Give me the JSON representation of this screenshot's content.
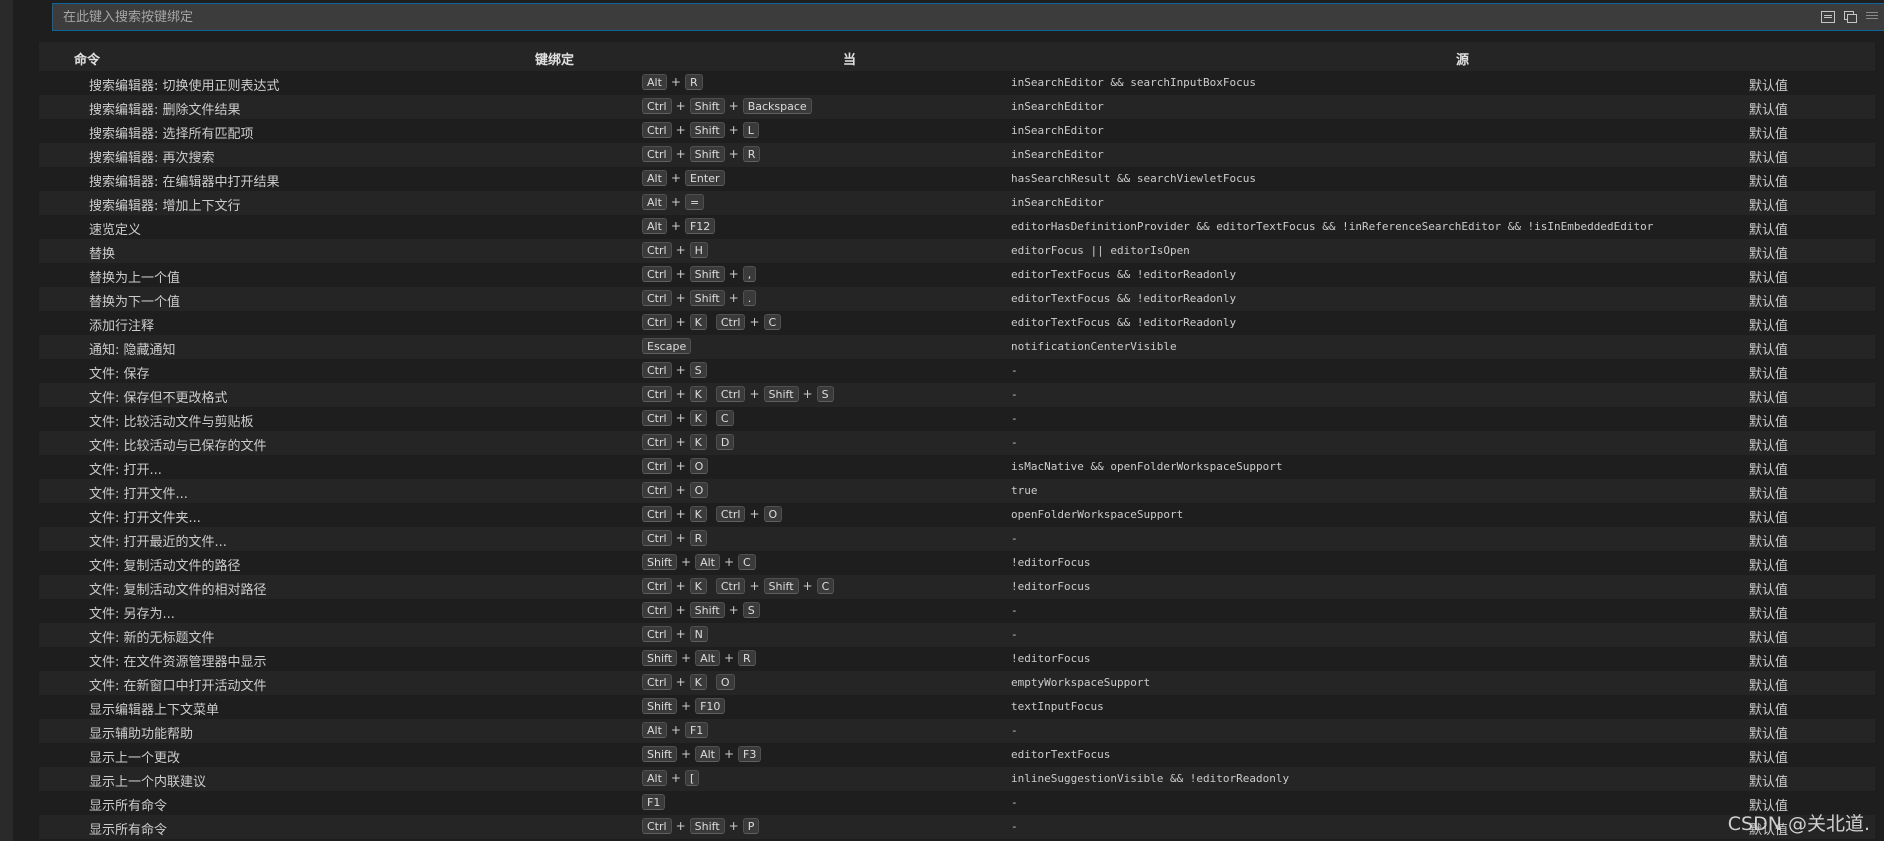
{
  "search": {
    "placeholder": "在此键入搜索按键绑定"
  },
  "header": {
    "command": "命令",
    "keybinding": "键绑定",
    "when": "当",
    "source": "源"
  },
  "rows": [
    {
      "command": "搜索编辑器: 切换使用正则表达式",
      "keys": [
        [
          "Alt",
          "R"
        ]
      ],
      "when": "inSearchEditor && searchInputBoxFocus",
      "source": "默认值"
    },
    {
      "command": "搜索编辑器: 删除文件结果",
      "keys": [
        [
          "Ctrl",
          "Shift",
          "Backspace"
        ]
      ],
      "when": "inSearchEditor",
      "source": "默认值"
    },
    {
      "command": "搜索编辑器: 选择所有匹配项",
      "keys": [
        [
          "Ctrl",
          "Shift",
          "L"
        ]
      ],
      "when": "inSearchEditor",
      "source": "默认值"
    },
    {
      "command": "搜索编辑器: 再次搜索",
      "keys": [
        [
          "Ctrl",
          "Shift",
          "R"
        ]
      ],
      "when": "inSearchEditor",
      "source": "默认值"
    },
    {
      "command": "搜索编辑器: 在编辑器中打开结果",
      "keys": [
        [
          "Alt",
          "Enter"
        ]
      ],
      "when": "hasSearchResult && searchViewletFocus",
      "source": "默认值"
    },
    {
      "command": "搜索编辑器: 增加上下文行",
      "keys": [
        [
          "Alt",
          "="
        ]
      ],
      "when": "inSearchEditor",
      "source": "默认值"
    },
    {
      "command": "速览定义",
      "keys": [
        [
          "Alt",
          "F12"
        ]
      ],
      "when": "editorHasDefinitionProvider && editorTextFocus && !inReferenceSearchEditor && !isInEmbeddedEditor",
      "source": "默认值"
    },
    {
      "command": "替换",
      "keys": [
        [
          "Ctrl",
          "H"
        ]
      ],
      "when": "editorFocus || editorIsOpen",
      "source": "默认值"
    },
    {
      "command": "替换为上一个值",
      "keys": [
        [
          "Ctrl",
          "Shift",
          ","
        ]
      ],
      "when": "editorTextFocus && !editorReadonly",
      "source": "默认值"
    },
    {
      "command": "替换为下一个值",
      "keys": [
        [
          "Ctrl",
          "Shift",
          "."
        ]
      ],
      "when": "editorTextFocus && !editorReadonly",
      "source": "默认值"
    },
    {
      "command": "添加行注释",
      "keys": [
        [
          "Ctrl",
          "K"
        ],
        [
          "Ctrl",
          "C"
        ]
      ],
      "when": "editorTextFocus && !editorReadonly",
      "source": "默认值"
    },
    {
      "command": "通知: 隐藏通知",
      "keys": [
        [
          "Escape"
        ]
      ],
      "when": "notificationCenterVisible",
      "source": "默认值"
    },
    {
      "command": "文件: 保存",
      "keys": [
        [
          "Ctrl",
          "S"
        ]
      ],
      "when": "-",
      "source": "默认值"
    },
    {
      "command": "文件: 保存但不更改格式",
      "keys": [
        [
          "Ctrl",
          "K"
        ],
        [
          "Ctrl",
          "Shift",
          "S"
        ]
      ],
      "when": "-",
      "source": "默认值"
    },
    {
      "command": "文件: 比较活动文件与剪贴板",
      "keys": [
        [
          "Ctrl",
          "K"
        ],
        [
          "C"
        ]
      ],
      "when": "-",
      "source": "默认值"
    },
    {
      "command": "文件: 比较活动与已保存的文件",
      "keys": [
        [
          "Ctrl",
          "K"
        ],
        [
          "D"
        ]
      ],
      "when": "-",
      "source": "默认值"
    },
    {
      "command": "文件: 打开...",
      "keys": [
        [
          "Ctrl",
          "O"
        ]
      ],
      "when": "isMacNative && openFolderWorkspaceSupport",
      "source": "默认值"
    },
    {
      "command": "文件: 打开文件...",
      "keys": [
        [
          "Ctrl",
          "O"
        ]
      ],
      "when": "true",
      "source": "默认值"
    },
    {
      "command": "文件: 打开文件夹...",
      "keys": [
        [
          "Ctrl",
          "K"
        ],
        [
          "Ctrl",
          "O"
        ]
      ],
      "when": "openFolderWorkspaceSupport",
      "source": "默认值"
    },
    {
      "command": "文件: 打开最近的文件...",
      "keys": [
        [
          "Ctrl",
          "R"
        ]
      ],
      "when": "-",
      "source": "默认值"
    },
    {
      "command": "文件: 复制活动文件的路径",
      "keys": [
        [
          "Shift",
          "Alt",
          "C"
        ]
      ],
      "when": "!editorFocus",
      "source": "默认值"
    },
    {
      "command": "文件: 复制活动文件的相对路径",
      "keys": [
        [
          "Ctrl",
          "K"
        ],
        [
          "Ctrl",
          "Shift",
          "C"
        ]
      ],
      "when": "!editorFocus",
      "source": "默认值"
    },
    {
      "command": "文件: 另存为...",
      "keys": [
        [
          "Ctrl",
          "Shift",
          "S"
        ]
      ],
      "when": "-",
      "source": "默认值"
    },
    {
      "command": "文件: 新的无标题文件",
      "keys": [
        [
          "Ctrl",
          "N"
        ]
      ],
      "when": "-",
      "source": "默认值"
    },
    {
      "command": "文件: 在文件资源管理器中显示",
      "keys": [
        [
          "Shift",
          "Alt",
          "R"
        ]
      ],
      "when": "!editorFocus",
      "source": "默认值"
    },
    {
      "command": "文件: 在新窗口中打开活动文件",
      "keys": [
        [
          "Ctrl",
          "K"
        ],
        [
          "O"
        ]
      ],
      "when": "emptyWorkspaceSupport",
      "source": "默认值"
    },
    {
      "command": "显示编辑器上下文菜单",
      "keys": [
        [
          "Shift",
          "F10"
        ]
      ],
      "when": "textInputFocus",
      "source": "默认值"
    },
    {
      "command": "显示辅助功能帮助",
      "keys": [
        [
          "Alt",
          "F1"
        ]
      ],
      "when": "-",
      "source": "默认值"
    },
    {
      "command": "显示上一个更改",
      "keys": [
        [
          "Shift",
          "Alt",
          "F3"
        ]
      ],
      "when": "editorTextFocus",
      "source": "默认值"
    },
    {
      "command": "显示上一个内联建议",
      "keys": [
        [
          "Alt",
          "["
        ]
      ],
      "when": "inlineSuggestionVisible && !editorReadonly",
      "source": "默认值"
    },
    {
      "command": "显示所有命令",
      "keys": [
        [
          "F1"
        ]
      ],
      "when": "-",
      "source": "默认值"
    },
    {
      "command": "显示所有命令",
      "keys": [
        [
          "Ctrl",
          "Shift",
          "P"
        ]
      ],
      "when": "-",
      "source": "默认值"
    }
  ],
  "watermark": "CSDN @关北道.",
  "icons": [
    "keyboard-record-icon",
    "sort-by-precedence-icon",
    "clear-search-icon"
  ]
}
